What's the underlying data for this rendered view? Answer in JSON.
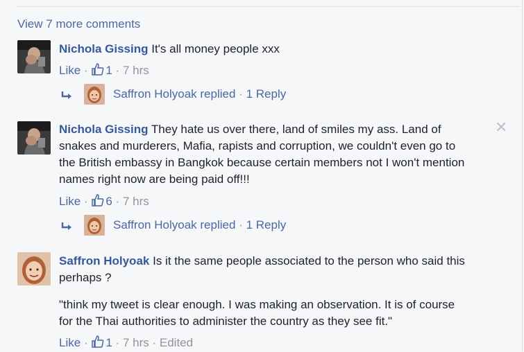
{
  "view_more": "View 7 more comments",
  "comments": [
    {
      "author": "Nichola Gissing",
      "text": "It's all money people xxx",
      "like_label": "Like",
      "likes": "1",
      "time": "7 hrs",
      "reply_summary": {
        "name": "Saffron Holyoak",
        "replied": "replied",
        "replies": "1 Reply"
      }
    },
    {
      "author": "Nichola Gissing",
      "text_lines": [
        "They hate us over there, land of smiles my ass. Land of",
        "snakes and murderers, Mafia, rapists and corruption, we couldn't even go to",
        "the British embassy in Bangkok because certain members not I won't mention",
        "names right now are being paid off!!!"
      ],
      "like_label": "Like",
      "likes": "6",
      "time": "7 hrs",
      "close_glyph": "✕",
      "reply_summary": {
        "name": "Saffron Holyoak",
        "replied": "replied",
        "replies": "1 Reply"
      }
    },
    {
      "author": "Saffron Holyoak",
      "text_lines": [
        "Is it the same people associated to the person who said this",
        "perhaps ?"
      ],
      "quote_lines": [
        "\"think my tweet is clear enough. I was making an observation. It is of course",
        "for the Thai authorities to administer the country as they see fit.\""
      ],
      "like_label": "Like",
      "likes": "1",
      "time": "7 hrs",
      "edited": "Edited"
    }
  ],
  "separator": "·",
  "colors": {
    "link": "#4b67a1",
    "author": "#365899",
    "meta": "#90949c",
    "background": "#f6f7f9"
  },
  "icons": [
    "thumbs-up-icon",
    "reply-arrow-icon",
    "close-icon"
  ]
}
